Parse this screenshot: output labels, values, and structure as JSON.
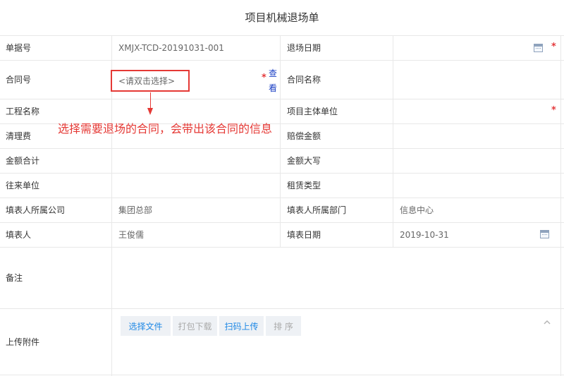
{
  "title": "项目机械退场单",
  "fields": {
    "bill_no_label": "单据号",
    "bill_no_value": "XMJX-TCD-20191031-001",
    "exit_date_label": "退场日期",
    "contract_no_label": "合同号",
    "contract_no_placeholder": "<请双击选择>",
    "view_link": "查看",
    "contract_name_label": "合同名称",
    "project_name_label": "工程名称",
    "main_unit_label": "项目主体单位",
    "cleanup_fee_label": "清理费",
    "compensation_label": "赔偿金额",
    "total_amount_label": "金额合计",
    "amount_caps_label": "金额大写",
    "counterparty_label": "往来单位",
    "lease_type_label": "租赁类型",
    "filler_company_label": "填表人所属公司",
    "filler_company_value": "集团总部",
    "filler_dept_label": "填表人所属部门",
    "filler_dept_value": "信息中心",
    "filler_label": "填表人",
    "filler_value": "王俊儒",
    "fill_date_label": "填表日期",
    "fill_date_value": "2019-10-31",
    "remarks_label": "备注",
    "attachments_label": "上传附件"
  },
  "required_mark": "*",
  "annotation": "选择需要退场的合同，会带出该合同的信息",
  "attachment_buttons": {
    "select_file": "选择文件",
    "pack_download": "打包下载",
    "scan_upload": "扫码上传",
    "sort": "排 序"
  },
  "colors": {
    "required": "#e4393c",
    "annotation": "#e53935",
    "link": "#1a3fc4",
    "button_active": "#1e88e5"
  }
}
